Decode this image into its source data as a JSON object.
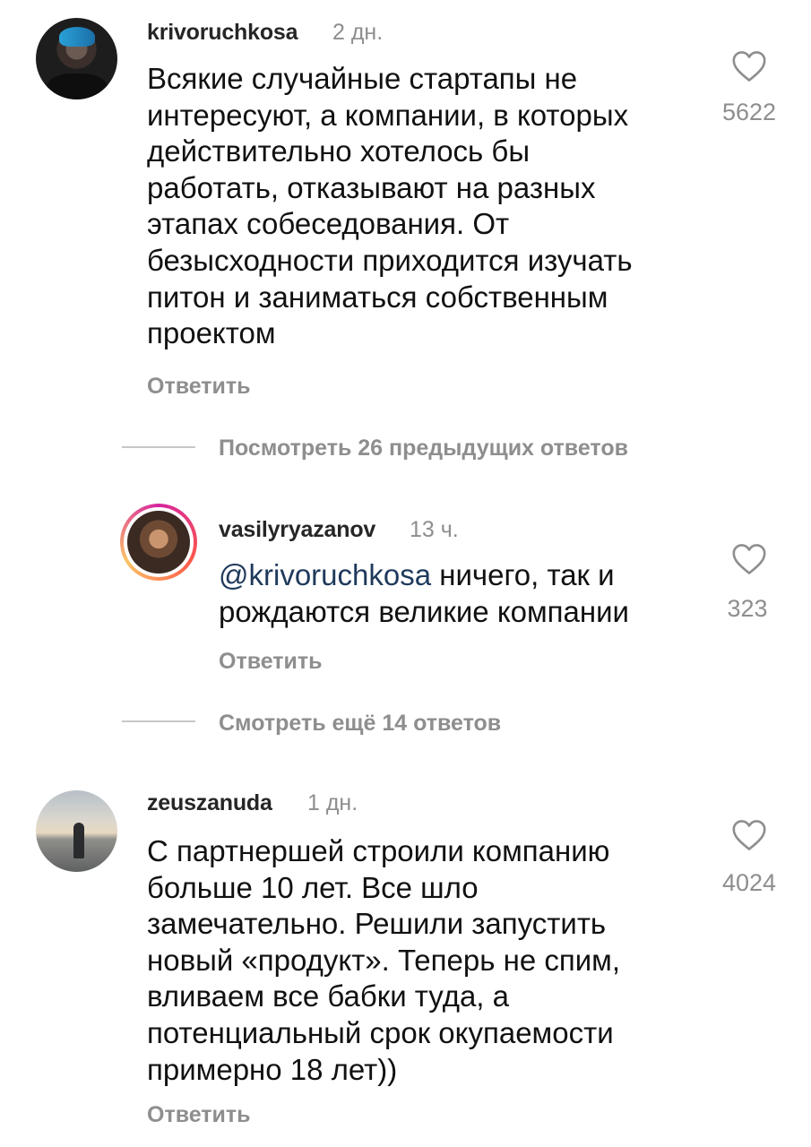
{
  "comments": [
    {
      "username": "krivoruchkosa",
      "time": "2 дн.",
      "text": "Всякие случайные стартапы не\nинтересуют, а компании, в которых\nдействительно хотелось бы\nработать, отказывают на разных\nэтапах собеседования.  От\nбезысходности приходится изучать\nпитон и заниматься собственным\nпроектом",
      "reply": "Ответить",
      "likes": "5622"
    },
    {
      "username": "vasilyryazanov",
      "time": "13 ч.",
      "mention": "@krivoruchkosa",
      "text_line1": " ничего, так и",
      "text_line2": "рождаются великие компании",
      "reply": "Ответить",
      "likes": "323"
    },
    {
      "username": "zeuszanuda",
      "time": "1 дн.",
      "text": "С партнершей строили компанию\nбольше 10 лет. Все шло\nзамечательно. Решили запустить\nновый «продукт». Теперь не спим,\nвливаем все бабки туда, а\nпотенциальный срок окупаемости\nпримерно 18 лет))",
      "reply": "Ответить",
      "likes": "4024"
    }
  ],
  "threads": {
    "view_previous": "Посмотреть 26 предыдущих ответов",
    "view_more": "Смотреть ещё 14 ответов"
  },
  "icons": {
    "like": "heart-outline-icon"
  },
  "colors": {
    "muted": "#8e8e8e",
    "mention": "#1f3a5c",
    "story_ring": "#d6249f"
  }
}
